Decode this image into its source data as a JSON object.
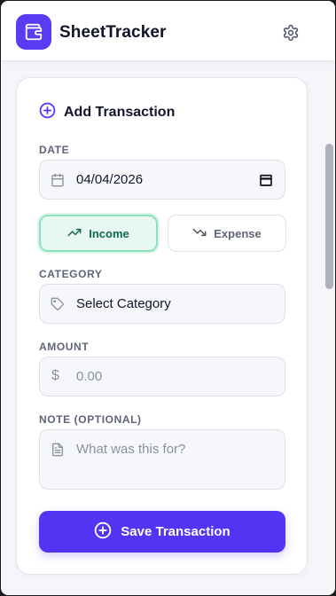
{
  "app": {
    "title": "SheetTracker",
    "brand_color": "#5b3cf5",
    "logo_icon": "wallet-icon",
    "settings_icon": "gear-icon"
  },
  "form": {
    "title": "Add Transaction",
    "title_icon": "plus-circle-icon",
    "date": {
      "label": "DATE",
      "value": "04/04/2026"
    },
    "type_toggle": {
      "income_label": "Income",
      "expense_label": "Expense",
      "selected": "Income"
    },
    "category": {
      "label": "CATEGORY",
      "value": "Select Category"
    },
    "amount": {
      "label": "AMOUNT",
      "placeholder": "0.00",
      "currency_symbol": "$"
    },
    "note": {
      "label": "NOTE (OPTIONAL)",
      "placeholder": "What was this for?"
    },
    "save_label": "Save Transaction",
    "accent_color": "#5533f2",
    "income_color": "#0f6b4b"
  }
}
